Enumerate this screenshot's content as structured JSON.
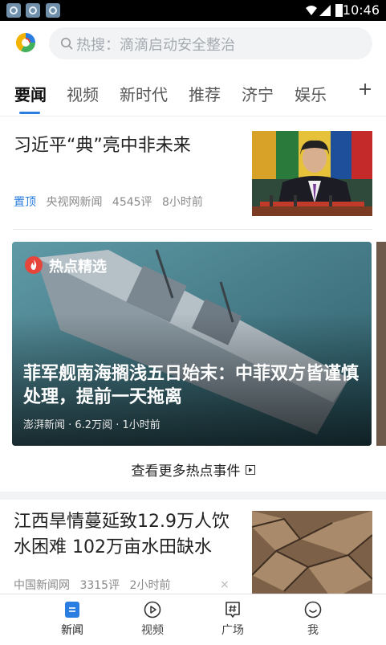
{
  "status_bar": {
    "time": "10:46"
  },
  "search": {
    "placeholder": "热搜：滴滴启动安全整治"
  },
  "tabs": [
    {
      "label": "要闻",
      "active": true
    },
    {
      "label": "视频"
    },
    {
      "label": "新时代"
    },
    {
      "label": "推荐"
    },
    {
      "label": "济宁"
    },
    {
      "label": "娱乐"
    }
  ],
  "feed": {
    "top_story": {
      "title": "习近平“典”亮中非未来",
      "pin": "置顶",
      "source": "央视网新闻",
      "comments": "4545评",
      "time": "8小时前"
    },
    "hot": {
      "badge": "热点精选",
      "title": "菲军舰南海搁浅五日始末：中菲双方皆谨慎处理，提前一天拖离",
      "meta": "澎湃新闻 · 6.2万阅 · 1小时前",
      "more": "查看更多热点事件"
    },
    "story2": {
      "title": "江西旱情蔓延致12.9万人饮水困难 102万亩水田缺水",
      "source": "中国新闻网",
      "comments": "3315评",
      "time": "2小时前",
      "close": "×"
    }
  },
  "bottom_nav": [
    {
      "label": "新闻",
      "icon": "news-icon",
      "active": true
    },
    {
      "label": "视频",
      "icon": "play-icon"
    },
    {
      "label": "广场",
      "icon": "hash-icon"
    },
    {
      "label": "我",
      "icon": "smiley-icon"
    }
  ],
  "colors": {
    "accent": "#2a7de1",
    "hot_red": "#e5453b"
  }
}
